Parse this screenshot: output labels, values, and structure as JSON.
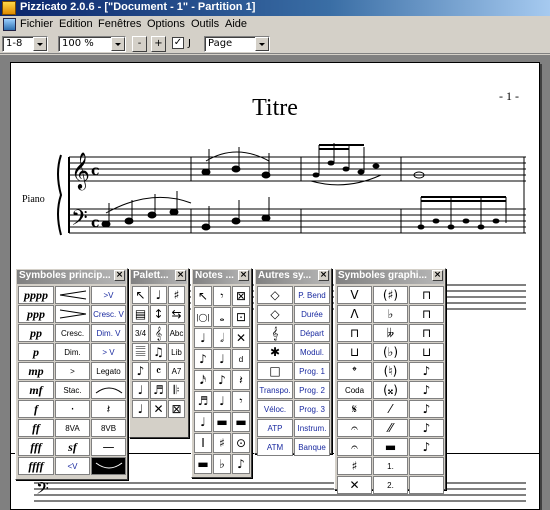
{
  "window": {
    "title": "Pizzicato 2.0.6 - [\"Document - 1\" - Partition 1]"
  },
  "menu": [
    "Fichier",
    "Edition",
    "Fenêtres",
    "Options",
    "Outils",
    "Aide"
  ],
  "toolbar": {
    "measures": "1-8",
    "zoom": "100 %",
    "minus": "-",
    "plus": "+",
    "checkbox_mark": "✓",
    "checkbox_label": "J",
    "view": "Page"
  },
  "score": {
    "title": "Titre",
    "page_number": "- 1 -",
    "instrument": "Piano"
  },
  "palettes": {
    "principaux": {
      "title": "Symboles princip...",
      "cells": [
        "pppp",
        "",
        ">V",
        "ppp",
        "",
        "Cresc. V",
        "pp",
        "Cresc.",
        "Dim. V",
        "p",
        "Dim.",
        "> V",
        "mp",
        ">",
        "Legato",
        "mf",
        "Stac.",
        "",
        "f",
        "·",
        "𝄽",
        "ff",
        "8VA",
        "8VB",
        "fff",
        "sf",
        "—",
        "ffff",
        "<V",
        ""
      ]
    },
    "palettes": {
      "title": "Palett...",
      "cells": [
        "↖",
        "♩",
        "♯",
        "▤",
        "↕",
        "⇆",
        "3/4",
        "𝄞",
        "Abc",
        "𝄚",
        "♫",
        "Lib",
        "♪",
        "𝄴",
        "A7",
        "♩",
        "♬",
        "𝄆",
        "♩",
        "✕",
        "⊠"
      ]
    },
    "notes": {
      "title": "Notes ...",
      "cells": [
        "↖",
        "𝄾",
        "⊠",
        "|◯|",
        "𝅝",
        "⊡",
        "♩",
        "𝅗𝅥",
        "✕",
        "♪",
        "♩",
        "d",
        "𝅘𝅥𝅯",
        "♪",
        "𝄽",
        "♬",
        "♩",
        "𝄾",
        "♩",
        "▬",
        "▬",
        "I",
        "♯",
        "⊙",
        "▬",
        "♭",
        "♪"
      ]
    },
    "autres": {
      "title": "Autres sy...",
      "cells": [
        "◇",
        "P. Bend",
        "◇",
        "Durée",
        "𝄞",
        "Départ",
        "✱",
        "Modul.",
        "□",
        "Prog. 1",
        "Transpo.",
        "Prog. 2",
        "Véloc.",
        "Prog. 3",
        "ATP",
        "Instrum.",
        "ATM",
        "Banque"
      ]
    },
    "graphiques": {
      "title": "Symboles graphi...",
      "cells": [
        "V",
        "(♯)",
        "⊓",
        "Λ",
        "♭",
        "⊓",
        "⊓",
        "𝄫",
        "⊓",
        "⊔",
        "(♭)",
        "⊔",
        "𝄌",
        "(♮)",
        "♪",
        "Coda",
        "(𝄪)",
        "♪",
        "𝄋",
        "⁄",
        "♪",
        "𝄐",
        "⁄⁄",
        "♪",
        "𝄐",
        "▬",
        "♪",
        "♯",
        "1.",
        "",
        "✕",
        "2.",
        ""
      ]
    }
  }
}
